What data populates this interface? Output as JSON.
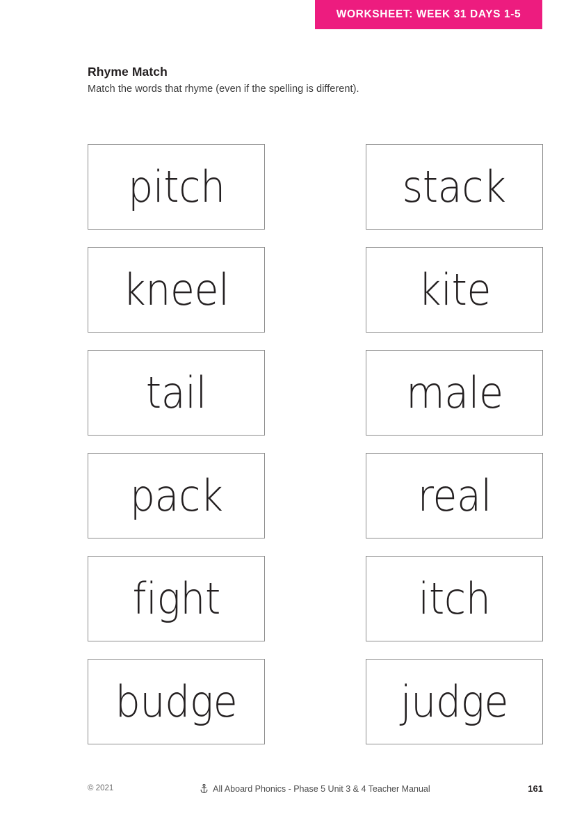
{
  "banner": {
    "label": "WORKSHEET: WEEK 31 DAYS 1-5",
    "background_color": "#ED1C7F",
    "text_color": "#FFFFFF"
  },
  "header": {
    "title": "Rhyme Match",
    "subtitle": "Match the words that rhyme (even if the spelling is different)."
  },
  "activity": {
    "rows": [
      {
        "left": "pitch",
        "right": "stack"
      },
      {
        "left": "kneel",
        "right": "kite"
      },
      {
        "left": "tail",
        "right": "male"
      },
      {
        "left": "pack",
        "right": "real"
      },
      {
        "left": "fight",
        "right": "itch"
      },
      {
        "left": "budge",
        "right": "judge"
      }
    ]
  },
  "footer": {
    "copyright": "© 2021",
    "icon": "anchor-icon",
    "source": "All Aboard Phonics - Phase 5 Unit 3 & 4 Teacher Manual",
    "page_number": "161"
  }
}
